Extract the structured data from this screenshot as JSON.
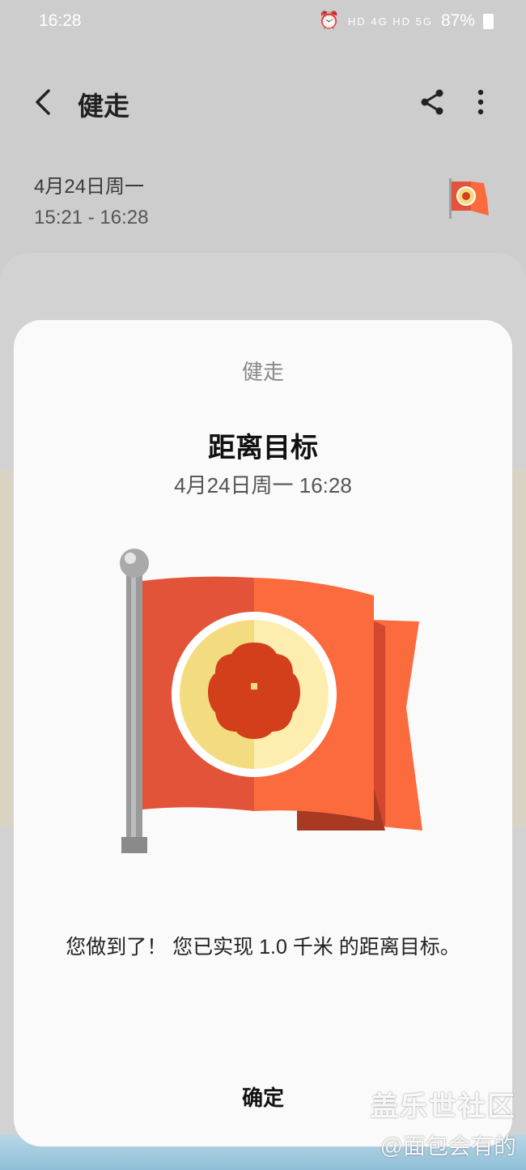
{
  "status_bar": {
    "time": "16:28",
    "network": "HD 4G HD 5G",
    "battery": "87%"
  },
  "header": {
    "title": "健走"
  },
  "session": {
    "date": "4月24日周一",
    "time_range": "15:21 - 16:28"
  },
  "dialog": {
    "category": "健走",
    "title": "距离目标",
    "datetime": "4月24日周一 16:28",
    "message": "您做到了！ 您已实现 1.0 千米 的距离目标。",
    "confirm_label": "确定"
  },
  "watermark": {
    "line1": "盖乐世社区",
    "line2": "@面包会有的"
  },
  "icons": {
    "back": "chevron-left-icon",
    "share": "share-icon",
    "more": "more-vertical-icon",
    "flag": "goal-flag-icon"
  },
  "colors": {
    "flag_red": "#e2533a",
    "flag_orange": "#fb6b3e",
    "medal_yellow": "#f3dc80",
    "dialog_bg": "#fafafa"
  }
}
